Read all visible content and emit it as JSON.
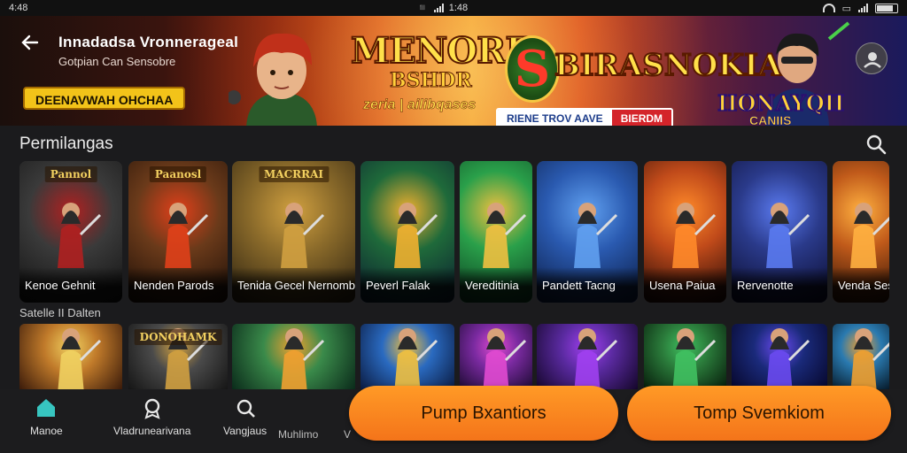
{
  "status_bar": {
    "left": "4:48",
    "center": "1:48"
  },
  "banner": {
    "title": "Innadadsa Vronnerageal",
    "subtitle": "Gotpian Can Sensobre",
    "pill": "DEENAVWAH OHCHAA",
    "logo_main": "MENORE",
    "logo_sub": "BSHDR",
    "logo_tag": "zeria | ailibqases",
    "logo_s": "S",
    "logo_right": "BIRASNOKIA",
    "btn_a": "RIENE TROV AAVE",
    "btn_b": "BIERDM",
    "logo_right2": "IIONAYQII",
    "logo_right3": "CANIIS"
  },
  "section_title": "Permilangas",
  "section2_title": "Satelle II Dalten",
  "tiles_row1": [
    {
      "badge": "Pannol",
      "caption": "Kenoe Gehnit",
      "c1": "#3a3a3a",
      "c2": "#111111",
      "accent": "#b02020"
    },
    {
      "badge": "Paanosl",
      "caption": "Nenden Parods",
      "c1": "#6a3a1a",
      "c2": "#1a0d06",
      "accent": "#e0401a"
    },
    {
      "badge": "MACRRAI",
      "caption": "Tenida Gecel Nernomber",
      "c1": "#8a6a2a",
      "c2": "#2a2010",
      "accent": "#d0a040"
    },
    {
      "badge": "",
      "caption": "Peverl Falak",
      "c1": "#1f6a3a",
      "c2": "#0a1a30",
      "accent": "#f0b030"
    },
    {
      "badge": "",
      "caption": "Vereditinia",
      "c1": "#2aa04a",
      "c2": "#0a3a20",
      "accent": "#f0c040"
    },
    {
      "badge": "",
      "caption": "Pandett Tacng",
      "c1": "#2a5ab0",
      "c2": "#0a1a40",
      "accent": "#60a0f0"
    },
    {
      "badge": "",
      "caption": "Usena Paiua",
      "c1": "#c04a1a",
      "c2": "#1a0606",
      "accent": "#ff8a2a"
    },
    {
      "badge": "",
      "caption": "Rervenotte",
      "c1": "#2a3a8a",
      "c2": "#0a0a2a",
      "accent": "#5a7af0"
    },
    {
      "badge": "",
      "caption": "Venda Ses",
      "c1": "#c05a1a",
      "c2": "#2a1006",
      "accent": "#ffb040"
    }
  ],
  "tiles_row2": [
    {
      "badge": "",
      "c1": "#c07a2a",
      "c2": "#3a1a0a",
      "accent": "#f0d060"
    },
    {
      "badge": "DONOHAMK",
      "c1": "#4a4a4a",
      "c2": "#151515",
      "accent": "#d0a040"
    },
    {
      "badge": "",
      "c1": "#3a8a4a",
      "c2": "#0a2a1a",
      "accent": "#f0a030"
    },
    {
      "badge": "",
      "c1": "#2a6ac0",
      "c2": "#0a1a40",
      "accent": "#f0c040"
    },
    {
      "badge": "",
      "c1": "#7a2aa0",
      "c2": "#1a0a30",
      "accent": "#e04ad0"
    },
    {
      "badge": "",
      "c1": "#5a2aa0",
      "c2": "#14062a",
      "accent": "#a040f0"
    },
    {
      "badge": "",
      "c1": "#2a7a3a",
      "c2": "#061a0a",
      "accent": "#40c060"
    },
    {
      "badge": "",
      "c1": "#1a2a7a",
      "c2": "#06062a",
      "accent": "#6a4af0"
    },
    {
      "badge": "",
      "c1": "#2a7ab0",
      "c2": "#061a2a",
      "accent": "#f0a030"
    }
  ],
  "bottom_nav": {
    "home": "Manoe",
    "item2": "Vladrunearivana",
    "item3": "Vangjaus",
    "item3b": "Muhlimo",
    "item4": "V"
  },
  "cta_left": "Pump Bxantiors",
  "cta_right": "Tomp Svemkiom",
  "colors": {
    "accent_orange": "#f4841f",
    "home_icon": "#37c5c0",
    "background": "#1b1b1d"
  }
}
